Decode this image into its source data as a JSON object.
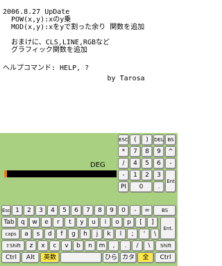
{
  "top_text": {
    "lines": [
      "2006.8.27 UpDate",
      "  POW(x,y):xのy乗",
      "  MOD(x,y):xをyで割った余り 関数を追加",
      "",
      "  おまけに、CLS,LINE,RGBなど",
      "  グラフィック関数を追加",
      "",
      "ヘルプコマンド: HELP, ?",
      "                         by Tarosa"
    ]
  },
  "calculator": {
    "mode": "DEG",
    "keys_row1": [
      "ESC",
      "(",
      ")",
      "DEL",
      "BS"
    ],
    "keys_row2": [
      "*",
      "7",
      "8",
      "9",
      "^"
    ],
    "keys_row3": [
      "/",
      "4",
      "5",
      "6",
      "-"
    ],
    "keys_row4": [
      "-",
      "1",
      "2",
      "3",
      "Ent"
    ],
    "keys_row5": [
      "PI",
      "0",
      "."
    ]
  },
  "keyboard": {
    "row1": [
      "Esc",
      "1",
      "2",
      "3",
      "4",
      "5",
      "6",
      "7",
      "8",
      "9",
      "0",
      "-",
      "=",
      "BS"
    ],
    "row2": [
      "Tab",
      "q",
      "w",
      "e",
      "r",
      "t",
      "y",
      "u",
      "i",
      "o",
      "p",
      "[",
      "]",
      "Ent."
    ],
    "row3": [
      "caps",
      "a",
      "s",
      "d",
      "f",
      "g",
      "h",
      "j",
      "k",
      "l",
      ";",
      "'",
      "\\"
    ],
    "row4": [
      "⇧Shift",
      "z",
      "x",
      "c",
      "v",
      "b",
      "n",
      "m",
      ",",
      ".",
      "/",
      "\\",
      "Shift"
    ],
    "row5": [
      "Ctrl",
      "Alt",
      "英数",
      "ひら",
      "カタ",
      "全",
      "Ctrl"
    ]
  }
}
